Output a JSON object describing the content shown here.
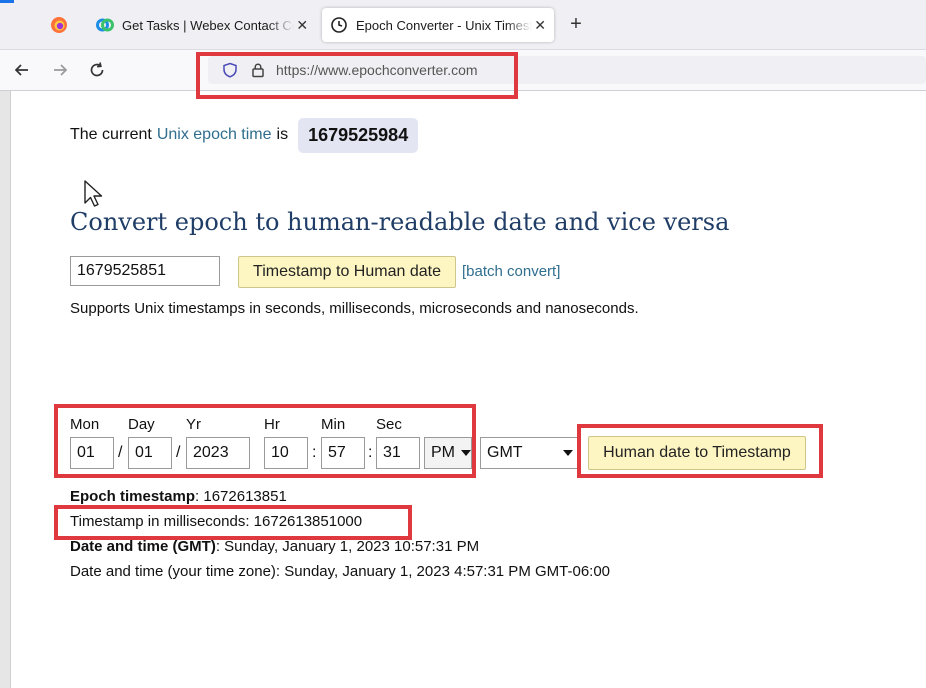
{
  "browser": {
    "tabs": [
      {
        "title": "Get Tasks | Webex Contact Center",
        "active": false
      },
      {
        "title": "Epoch Converter - Unix Timestamp",
        "active": true
      }
    ],
    "url": "https://www.epochconverter.com"
  },
  "page": {
    "current_prefix": "The current",
    "current_link": "Unix epoch time",
    "current_is": "is",
    "current_epoch": "1679525984",
    "heading": "Convert epoch to human-readable date and vice versa",
    "timestamp_input_value": "1679525851",
    "ts_to_human_button": "Timestamp to Human date",
    "batch_convert": "[batch convert]",
    "supports_text": "Supports Unix timestamps in seconds, milliseconds, microseconds and nanoseconds.",
    "labels": {
      "mon": "Mon",
      "day": "Day",
      "yr": "Yr",
      "hr": "Hr",
      "min": "Min",
      "sec": "Sec"
    },
    "values": {
      "mon": "01",
      "day": "01",
      "yr": "2023",
      "hr": "10",
      "min": "57",
      "sec": "31",
      "ampm": "PM",
      "timezone": "GMT"
    },
    "date_sep": "/",
    "time_sep": ":",
    "human_to_ts_button": "Human date to Timestamp",
    "results": {
      "epoch_label": "Epoch timestamp",
      "epoch_value": ": 1672613851",
      "ms_text": "Timestamp in milliseconds: 1672613851000",
      "gmt_label": "Date and time (GMT)",
      "gmt_value": ": Sunday, January 1, 2023 10:57:31 PM",
      "local_text": "Date and time (your time zone): Sunday, January 1, 2023 4:57:31 PM GMT-06:00"
    }
  },
  "colors": {
    "annotation_red": "#e0383f",
    "link": "#2f6e8e",
    "heading": "#1f3d66",
    "button_yellow": "#fdf6c3"
  }
}
